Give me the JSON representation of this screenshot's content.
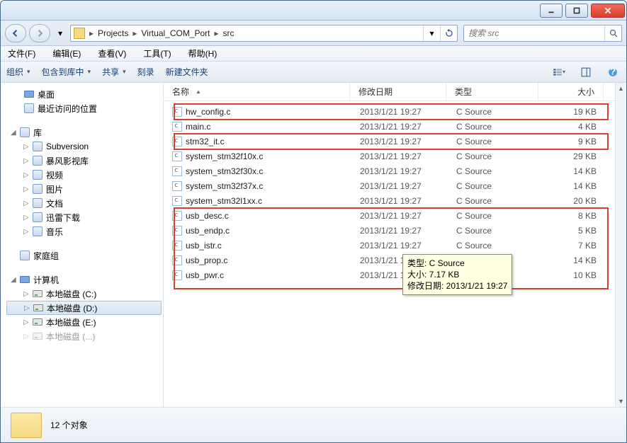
{
  "breadcrumb": {
    "items": [
      "Projects",
      "Virtual_COM_Port",
      "src"
    ]
  },
  "search": {
    "placeholder": "搜索 src"
  },
  "menu": {
    "file": "文件(F)",
    "edit": "编辑(E)",
    "view": "查看(V)",
    "tools": "工具(T)",
    "help": "帮助(H)"
  },
  "toolbar": {
    "organize": "组织",
    "include": "包含到库中",
    "share": "共享",
    "burn": "刻录",
    "newfolder": "新建文件夹"
  },
  "toolbar_right_icons": [
    "view-mode-icon",
    "preview-pane-icon",
    "help-icon"
  ],
  "columns": {
    "name": "名称",
    "date": "修改日期",
    "type": "类型",
    "size": "大小"
  },
  "tree": {
    "desktop": "桌面",
    "recent": "最近访问的位置",
    "libs": "库",
    "subversion": "Subversion",
    "storm": "暴风影视库",
    "video": "视频",
    "pictures": "图片",
    "docs": "文档",
    "xunlei": "迅雷下载",
    "music": "音乐",
    "homegroup": "家庭组",
    "computer": "计算机",
    "drive_c": "本地磁盘 (C:)",
    "drive_d": "本地磁盘 (D:)",
    "drive_e": "本地磁盘 (E:)",
    "drive_more": "本地磁盘 (...)"
  },
  "files": [
    {
      "name": "hw_config.c",
      "date": "2013/1/21 19:27",
      "type": "C Source",
      "size": "19 KB"
    },
    {
      "name": "main.c",
      "date": "2013/1/21 19:27",
      "type": "C Source",
      "size": "4 KB"
    },
    {
      "name": "stm32_it.c",
      "date": "2013/1/21 19:27",
      "type": "C Source",
      "size": "9 KB"
    },
    {
      "name": "system_stm32f10x.c",
      "date": "2013/1/21 19:27",
      "type": "C Source",
      "size": "29 KB"
    },
    {
      "name": "system_stm32f30x.c",
      "date": "2013/1/21 19:27",
      "type": "C Source",
      "size": "14 KB"
    },
    {
      "name": "system_stm32f37x.c",
      "date": "2013/1/21 19:27",
      "type": "C Source",
      "size": "14 KB"
    },
    {
      "name": "system_stm32l1xx.c",
      "date": "2013/1/21 19:27",
      "type": "C Source",
      "size": "20 KB"
    },
    {
      "name": "usb_desc.c",
      "date": "2013/1/21 19:27",
      "type": "C Source",
      "size": "8 KB"
    },
    {
      "name": "usb_endp.c",
      "date": "2013/1/21 19:27",
      "type": "C Source",
      "size": "5 KB"
    },
    {
      "name": "usb_istr.c",
      "date": "2013/1/21 19:27",
      "type": "C Source",
      "size": "7 KB"
    },
    {
      "name": "usb_prop.c",
      "date": "2013/1/21 19:27",
      "type": "C Source",
      "size": "14 KB"
    },
    {
      "name": "usb_pwr.c",
      "date": "2013/1/21 19:27",
      "type": "C Source",
      "size": "10 KB"
    }
  ],
  "tooltip": {
    "l1": "类型: C Source",
    "l2": "大小: 7.17 KB",
    "l3": "修改日期: 2013/1/21 19:27"
  },
  "status": {
    "count": "12 个对象"
  }
}
